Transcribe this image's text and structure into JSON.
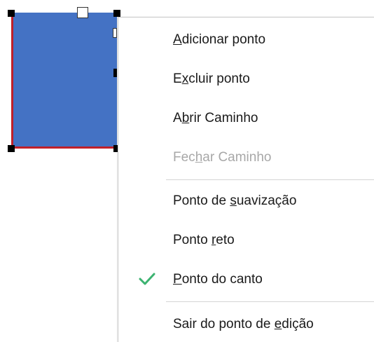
{
  "menu": {
    "items": [
      {
        "id": "adicionar",
        "pre": "",
        "accel": "A",
        "post": "dicionar ponto",
        "enabled": true,
        "checked": false
      },
      {
        "id": "excluir",
        "pre": "E",
        "accel": "x",
        "post": "cluir ponto",
        "enabled": true,
        "checked": false
      },
      {
        "id": "abrir",
        "pre": "A",
        "accel": "b",
        "post": "rir Caminho",
        "enabled": true,
        "checked": false
      },
      {
        "id": "fechar",
        "pre": "Fec",
        "accel": "h",
        "post": "ar Caminho",
        "enabled": false,
        "checked": false
      },
      {
        "id": "suavizacao",
        "pre": "Ponto de ",
        "accel": "s",
        "post": "uavização",
        "enabled": true,
        "checked": false
      },
      {
        "id": "reto",
        "pre": "Ponto ",
        "accel": "r",
        "post": "eto",
        "enabled": true,
        "checked": false
      },
      {
        "id": "canto",
        "pre": "",
        "accel": "P",
        "post": "onto do canto",
        "enabled": true,
        "checked": true
      },
      {
        "id": "sair",
        "pre": "Sair do ponto de ",
        "accel": "e",
        "post": "dição",
        "enabled": true,
        "checked": false
      }
    ]
  },
  "colors": {
    "shape_fill": "#4472C4",
    "shape_outline": "#C0202A",
    "check": "#3CB371",
    "disabled_text": "#A8A8A8"
  },
  "icons": {
    "check": "checkmark-icon"
  }
}
